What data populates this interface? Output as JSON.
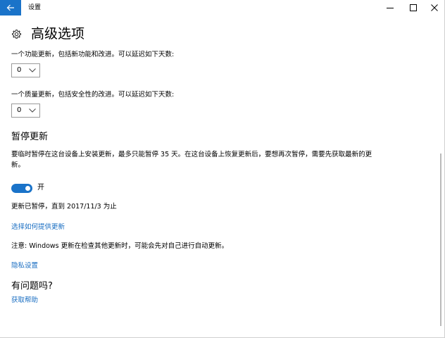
{
  "window": {
    "title": "设置"
  },
  "page": {
    "title": "高级选项"
  },
  "feature_update": {
    "label": "一个功能更新，包括新功能和改进。可以延迟如下天数:",
    "value": "0"
  },
  "quality_update": {
    "label": "一个质量更新，包括安全性的改进。可以延迟如下天数:",
    "value": "0"
  },
  "pause": {
    "heading": "暂停更新",
    "description": "要临时暂停在这台设备上安装更新，最多只能暂停 35 天。在这台设备上恢复更新后，要想再次暂停，需要先获取最新的更新。",
    "toggle_label": "开",
    "toggle_on": true,
    "status": "更新已暂停，直到 2017/11/3 为止"
  },
  "links": {
    "choose_delivery": "选择如何提供更新",
    "note": "注意: Windows 更新在检查其他更新时，可能会先对自己进行自动更新。",
    "privacy": "隐私设置"
  },
  "help": {
    "heading": "有问题吗?",
    "get_help": "获取帮助"
  },
  "colors": {
    "accent": "#1a73c9",
    "link": "#1a6ec2"
  },
  "icons": {
    "back": "arrow-left-icon",
    "minimize": "minimize-icon",
    "maximize": "maximize-icon",
    "close": "close-icon",
    "settings": "gear-icon",
    "dropdown": "chevron-down-icon"
  }
}
